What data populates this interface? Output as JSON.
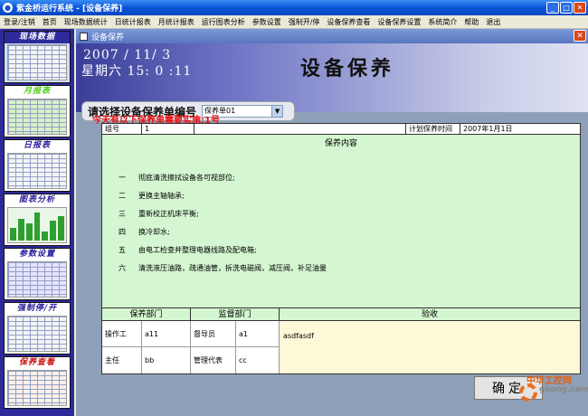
{
  "window": {
    "title": "紫金桥运行系统 - [设备保养]"
  },
  "menu": [
    "登录/注销",
    "首页",
    "现场数据统计",
    "日统计报表",
    "月统计报表",
    "运行图表分析",
    "参数设置",
    "强制开/停",
    "设备保养查看",
    "设备保养设置",
    "系统简介",
    "帮助",
    "退出"
  ],
  "sidebar": [
    {
      "label": "现场数据",
      "color": "white"
    },
    {
      "label": "月报表",
      "color": "lime"
    },
    {
      "label": "日报表",
      "color": "navy"
    },
    {
      "label": "图表分析",
      "color": "navy"
    },
    {
      "label": "参数设置",
      "color": "navy"
    },
    {
      "label": "强制停/开",
      "color": "navy"
    },
    {
      "label": "保养查看",
      "color": "red"
    }
  ],
  "child": {
    "title": "设备保养"
  },
  "datetime": {
    "date": "2007 / 11/  3",
    "week": "星期六 15: 0  :11"
  },
  "page_title": "设备保养",
  "selector": {
    "label": "请选择设备保养单编号",
    "value": "保养单01"
  },
  "notice": "今天有以下保养单需要实施:1号",
  "plan": {
    "group_label": "组号",
    "group_value": "1",
    "plan_time_label": "计划保养时间",
    "plan_time_value": "2007年1月1日",
    "content_header": "保养内容",
    "items": [
      {
        "num": "一",
        "text": "彻底清洗擦拭设备各可视部位;"
      },
      {
        "num": "二",
        "text": "更换主轴轴承;"
      },
      {
        "num": "三",
        "text": "重新校正机床平衡;"
      },
      {
        "num": "四",
        "text": "换冷却水;"
      },
      {
        "num": "五",
        "text": "由电工检查并整理电器线路及配电箱;"
      },
      {
        "num": "六",
        "text": "清洗液压油路，疏通油管，拆洗电磁阀，减压阀，补足油量"
      }
    ]
  },
  "sign": {
    "dept_label": "保养部门",
    "super_label": "监督部门",
    "accept_label": "验收",
    "operator_label": "操作工",
    "operator_value": "a11",
    "supervisor_label": "督导员",
    "supervisor_value": "a1",
    "director_label": "主任",
    "director_value": "bb",
    "manager_label": "管理代表",
    "manager_value": "cc",
    "accept_value": "asdfasdf"
  },
  "ok_button": "确定",
  "watermark": {
    "text": "中华工控网",
    "domain": "gkong.com"
  }
}
